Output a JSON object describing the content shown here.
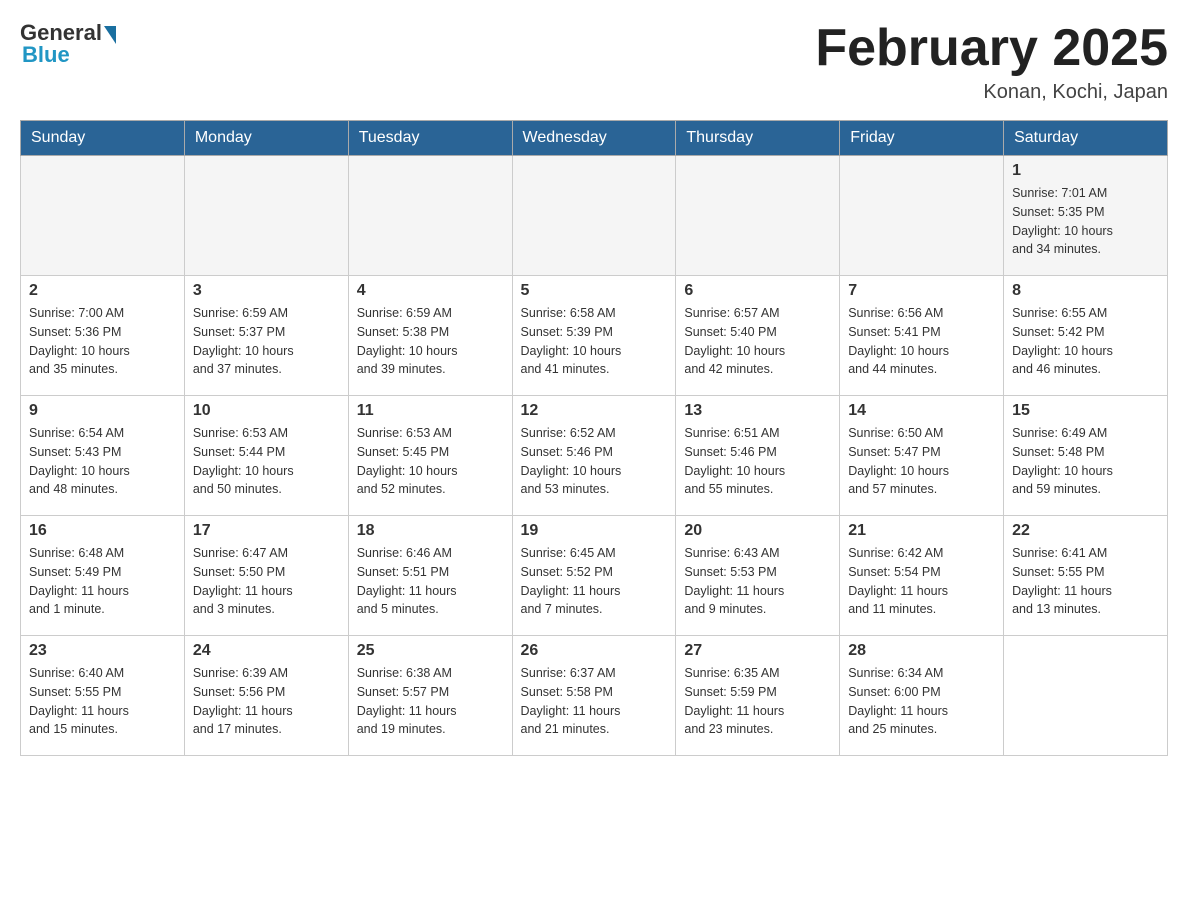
{
  "header": {
    "logo": {
      "general": "General",
      "blue": "Blue"
    },
    "title": "February 2025",
    "location": "Konan, Kochi, Japan"
  },
  "days_of_week": [
    "Sunday",
    "Monday",
    "Tuesday",
    "Wednesday",
    "Thursday",
    "Friday",
    "Saturday"
  ],
  "weeks": [
    {
      "cells": [
        {
          "day": "",
          "info": ""
        },
        {
          "day": "",
          "info": ""
        },
        {
          "day": "",
          "info": ""
        },
        {
          "day": "",
          "info": ""
        },
        {
          "day": "",
          "info": ""
        },
        {
          "day": "",
          "info": ""
        },
        {
          "day": "1",
          "info": "Sunrise: 7:01 AM\nSunset: 5:35 PM\nDaylight: 10 hours\nand 34 minutes."
        }
      ]
    },
    {
      "cells": [
        {
          "day": "2",
          "info": "Sunrise: 7:00 AM\nSunset: 5:36 PM\nDaylight: 10 hours\nand 35 minutes."
        },
        {
          "day": "3",
          "info": "Sunrise: 6:59 AM\nSunset: 5:37 PM\nDaylight: 10 hours\nand 37 minutes."
        },
        {
          "day": "4",
          "info": "Sunrise: 6:59 AM\nSunset: 5:38 PM\nDaylight: 10 hours\nand 39 minutes."
        },
        {
          "day": "5",
          "info": "Sunrise: 6:58 AM\nSunset: 5:39 PM\nDaylight: 10 hours\nand 41 minutes."
        },
        {
          "day": "6",
          "info": "Sunrise: 6:57 AM\nSunset: 5:40 PM\nDaylight: 10 hours\nand 42 minutes."
        },
        {
          "day": "7",
          "info": "Sunrise: 6:56 AM\nSunset: 5:41 PM\nDaylight: 10 hours\nand 44 minutes."
        },
        {
          "day": "8",
          "info": "Sunrise: 6:55 AM\nSunset: 5:42 PM\nDaylight: 10 hours\nand 46 minutes."
        }
      ]
    },
    {
      "cells": [
        {
          "day": "9",
          "info": "Sunrise: 6:54 AM\nSunset: 5:43 PM\nDaylight: 10 hours\nand 48 minutes."
        },
        {
          "day": "10",
          "info": "Sunrise: 6:53 AM\nSunset: 5:44 PM\nDaylight: 10 hours\nand 50 minutes."
        },
        {
          "day": "11",
          "info": "Sunrise: 6:53 AM\nSunset: 5:45 PM\nDaylight: 10 hours\nand 52 minutes."
        },
        {
          "day": "12",
          "info": "Sunrise: 6:52 AM\nSunset: 5:46 PM\nDaylight: 10 hours\nand 53 minutes."
        },
        {
          "day": "13",
          "info": "Sunrise: 6:51 AM\nSunset: 5:46 PM\nDaylight: 10 hours\nand 55 minutes."
        },
        {
          "day": "14",
          "info": "Sunrise: 6:50 AM\nSunset: 5:47 PM\nDaylight: 10 hours\nand 57 minutes."
        },
        {
          "day": "15",
          "info": "Sunrise: 6:49 AM\nSunset: 5:48 PM\nDaylight: 10 hours\nand 59 minutes."
        }
      ]
    },
    {
      "cells": [
        {
          "day": "16",
          "info": "Sunrise: 6:48 AM\nSunset: 5:49 PM\nDaylight: 11 hours\nand 1 minute."
        },
        {
          "day": "17",
          "info": "Sunrise: 6:47 AM\nSunset: 5:50 PM\nDaylight: 11 hours\nand 3 minutes."
        },
        {
          "day": "18",
          "info": "Sunrise: 6:46 AM\nSunset: 5:51 PM\nDaylight: 11 hours\nand 5 minutes."
        },
        {
          "day": "19",
          "info": "Sunrise: 6:45 AM\nSunset: 5:52 PM\nDaylight: 11 hours\nand 7 minutes."
        },
        {
          "day": "20",
          "info": "Sunrise: 6:43 AM\nSunset: 5:53 PM\nDaylight: 11 hours\nand 9 minutes."
        },
        {
          "day": "21",
          "info": "Sunrise: 6:42 AM\nSunset: 5:54 PM\nDaylight: 11 hours\nand 11 minutes."
        },
        {
          "day": "22",
          "info": "Sunrise: 6:41 AM\nSunset: 5:55 PM\nDaylight: 11 hours\nand 13 minutes."
        }
      ]
    },
    {
      "cells": [
        {
          "day": "23",
          "info": "Sunrise: 6:40 AM\nSunset: 5:55 PM\nDaylight: 11 hours\nand 15 minutes."
        },
        {
          "day": "24",
          "info": "Sunrise: 6:39 AM\nSunset: 5:56 PM\nDaylight: 11 hours\nand 17 minutes."
        },
        {
          "day": "25",
          "info": "Sunrise: 6:38 AM\nSunset: 5:57 PM\nDaylight: 11 hours\nand 19 minutes."
        },
        {
          "day": "26",
          "info": "Sunrise: 6:37 AM\nSunset: 5:58 PM\nDaylight: 11 hours\nand 21 minutes."
        },
        {
          "day": "27",
          "info": "Sunrise: 6:35 AM\nSunset: 5:59 PM\nDaylight: 11 hours\nand 23 minutes."
        },
        {
          "day": "28",
          "info": "Sunrise: 6:34 AM\nSunset: 6:00 PM\nDaylight: 11 hours\nand 25 minutes."
        },
        {
          "day": "",
          "info": ""
        }
      ]
    }
  ]
}
